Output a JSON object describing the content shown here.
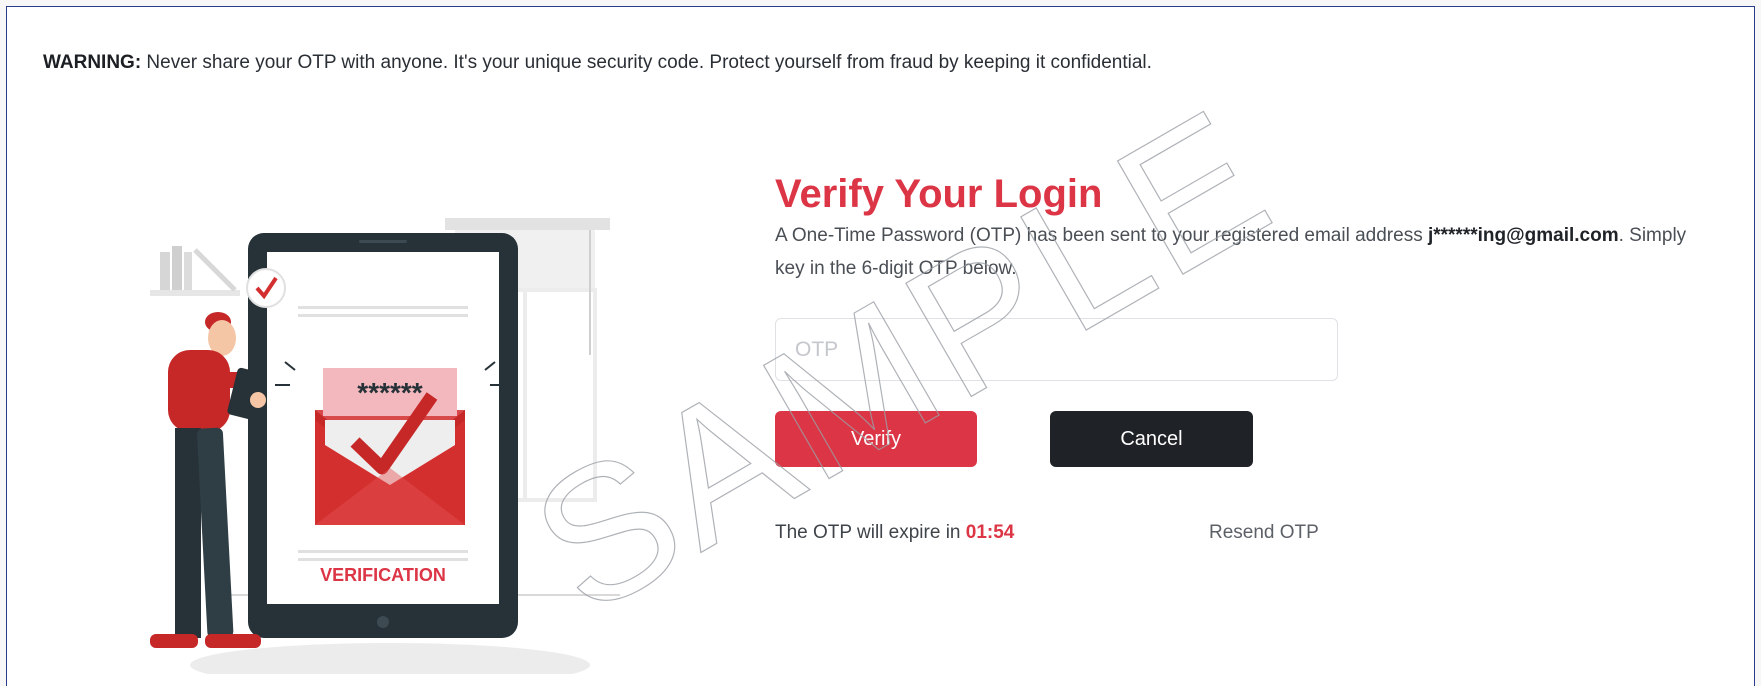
{
  "warning": {
    "label": "WARNING:",
    "text": " Never share your OTP with anyone. It's your unique security code. Protect yourself from fraud by keeping it confidential."
  },
  "illustration": {
    "code": "******",
    "caption": "VERIFICATION"
  },
  "verify": {
    "title": "Verify Your Login",
    "desc_before": "A One-Time Password (OTP) has been sent to your registered email address ",
    "email": "j******ing@gmail.com",
    "desc_after": ". Simply key in the 6-digit OTP below."
  },
  "otp": {
    "placeholder": "OTP",
    "value": ""
  },
  "buttons": {
    "verify": "Verify",
    "cancel": "Cancel"
  },
  "expiry": {
    "label": "The OTP will expire in ",
    "timer": "01:54"
  },
  "resend": "Resend OTP",
  "watermark": "SAMPLE",
  "colors": {
    "accent": "#dc3545",
    "dark": "#1f2226"
  }
}
